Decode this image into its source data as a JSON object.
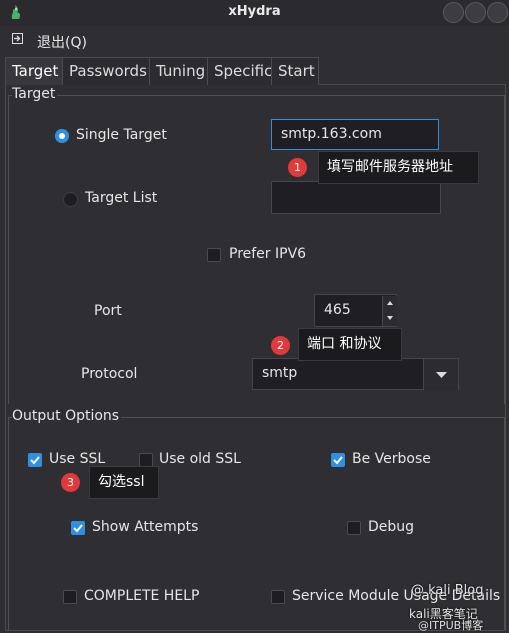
{
  "window": {
    "title": "xHydra"
  },
  "menu": {
    "exit_label": "退出(Q)"
  },
  "tabs": [
    {
      "label": "Target",
      "active": true
    },
    {
      "label": "Passwords",
      "active": false
    },
    {
      "label": "Tuning",
      "active": false
    },
    {
      "label": "Specific",
      "active": false
    },
    {
      "label": "Start",
      "active": false
    }
  ],
  "target_group": {
    "title": "Target",
    "single_target": {
      "label": "Single Target",
      "selected": true,
      "value": "smtp.163.com"
    },
    "target_list": {
      "label": "Target List",
      "selected": false,
      "value": ""
    },
    "prefer_ipv6": {
      "label": "Prefer IPV6",
      "checked": false
    },
    "port": {
      "label": "Port",
      "value": "465"
    },
    "protocol": {
      "label": "Protocol",
      "value": "smtp"
    }
  },
  "output_group": {
    "title": "Output Options",
    "use_ssl": {
      "label": "Use SSL",
      "checked": true
    },
    "use_old_ssl": {
      "label": "Use old SSL",
      "checked": false
    },
    "be_verbose": {
      "label": "Be Verbose",
      "checked": true
    },
    "show_attempts": {
      "label": "Show Attempts",
      "checked": true
    },
    "debug": {
      "label": "Debug",
      "checked": false
    },
    "complete_help": {
      "label": "COMPLETE HELP",
      "checked": false
    },
    "service_module_usage": {
      "label": "Service Module Usage Details",
      "checked": false
    }
  },
  "annotations": [
    {
      "number": "1",
      "text": "填写邮件服务器地址"
    },
    {
      "number": "2",
      "text": "端口 和协议"
    },
    {
      "number": "3",
      "text": "勾选ssl"
    }
  ],
  "watermark": {
    "line1": "@ kali Blog",
    "line2": "@ITPUB博客",
    "line3": "kali黑客笔记"
  },
  "colors": {
    "accent": "#2f8fe0",
    "badge": "#e03a3a",
    "background": "#2f2f33"
  }
}
